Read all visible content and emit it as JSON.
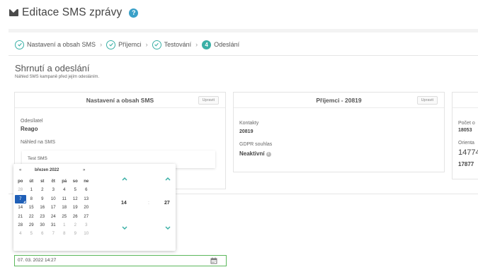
{
  "header": {
    "title": "Editace SMS zprávy",
    "help_glyph": "?"
  },
  "steps": [
    {
      "label": "Nastavení a obsah SMS",
      "state": "done"
    },
    {
      "label": "Příjemci",
      "state": "done"
    },
    {
      "label": "Testování",
      "state": "done"
    },
    {
      "label": "Odeslání",
      "state": "active",
      "number": "4"
    }
  ],
  "summary": {
    "title": "Shrnutí a odeslání",
    "subtitle": "Náhled SMS kampaně před jejím odesláním."
  },
  "card_settings": {
    "title": "Nastavení a obsah SMS",
    "edit": "Upravit",
    "sender_label": "Odesílatel",
    "sender_value": "Reago",
    "preview_label": "Náhled na SMS",
    "preview_text": "Test SMS"
  },
  "card_recipients": {
    "title": "Příjemci - 20819",
    "edit": "Upravit",
    "contacts_label": "Kontakty",
    "contacts_value": "20819",
    "gdpr_label": "GDPR souhlas",
    "gdpr_value": "Neaktivní",
    "info_glyph": "i"
  },
  "card_third": {
    "label1": "Počet o",
    "value1": "18053",
    "label2": "Orienta",
    "value2": "14774",
    "value3": "17877"
  },
  "datepicker": {
    "prev": "«",
    "month": "březen 2022",
    "next": "»",
    "weekdays": [
      "po",
      "út",
      "st",
      "čt",
      "pá",
      "so",
      "ne"
    ],
    "days": [
      {
        "d": "28",
        "m": true
      },
      {
        "d": "1"
      },
      {
        "d": "2"
      },
      {
        "d": "3"
      },
      {
        "d": "4"
      },
      {
        "d": "5"
      },
      {
        "d": "6"
      },
      {
        "d": "7",
        "sel": true
      },
      {
        "d": "8"
      },
      {
        "d": "9"
      },
      {
        "d": "10"
      },
      {
        "d": "11"
      },
      {
        "d": "12"
      },
      {
        "d": "13"
      },
      {
        "d": "14"
      },
      {
        "d": "15"
      },
      {
        "d": "16"
      },
      {
        "d": "17"
      },
      {
        "d": "18"
      },
      {
        "d": "19"
      },
      {
        "d": "20"
      },
      {
        "d": "21"
      },
      {
        "d": "22"
      },
      {
        "d": "23"
      },
      {
        "d": "24"
      },
      {
        "d": "25"
      },
      {
        "d": "26"
      },
      {
        "d": "27"
      },
      {
        "d": "28"
      },
      {
        "d": "29"
      },
      {
        "d": "30"
      },
      {
        "d": "31"
      },
      {
        "d": "1",
        "m": true
      },
      {
        "d": "2",
        "m": true
      },
      {
        "d": "3",
        "m": true
      },
      {
        "d": "4",
        "m": true
      },
      {
        "d": "5",
        "m": true
      },
      {
        "d": "6",
        "m": true
      },
      {
        "d": "7",
        "m": true
      },
      {
        "d": "8",
        "m": true
      },
      {
        "d": "9",
        "m": true
      },
      {
        "d": "10",
        "m": true
      }
    ],
    "hour": "14",
    "minute": "27",
    "colon": ":"
  },
  "datetime_input": {
    "value": "07. 03. 2022 14:27"
  },
  "colors": {
    "accent": "#3ab0a6",
    "selected": "#1f5fb7",
    "input_border": "#5cb85c",
    "help": "#3aa0c8"
  }
}
